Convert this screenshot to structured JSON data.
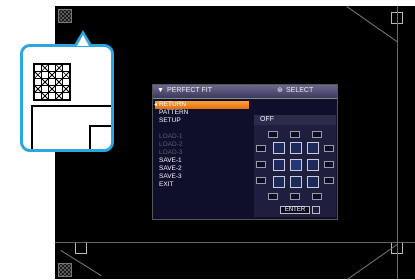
{
  "osd": {
    "title": "PERFECT FIT",
    "hint": "SELECT",
    "menu": [
      {
        "label": "RETURN",
        "state": "selected"
      },
      {
        "label": "PATTERN",
        "state": "normal"
      },
      {
        "label": "SETUP",
        "state": "normal"
      },
      {
        "label": "",
        "state": "gap"
      },
      {
        "label": "LOAD-1",
        "state": "disabled"
      },
      {
        "label": "LOAD-2",
        "state": "disabled"
      },
      {
        "label": "LOAD-3",
        "state": "disabled"
      },
      {
        "label": "SAVE-1",
        "state": "normal"
      },
      {
        "label": "SAVE-2",
        "state": "normal"
      },
      {
        "label": "SAVE-3",
        "state": "normal"
      },
      {
        "label": "EXIT",
        "state": "normal"
      }
    ],
    "pattern_value": "OFF",
    "enter_label": "ENTER",
    "icons": {
      "title": "perfect-fit-icon",
      "hint": "select-button-icon",
      "selection_marker": "triangle-right-icon",
      "enter": "enter-button-icon"
    }
  },
  "colors": {
    "accent": "#2aa6e0",
    "selected": "#f08a20",
    "osd_background": "#0f0f2c"
  }
}
